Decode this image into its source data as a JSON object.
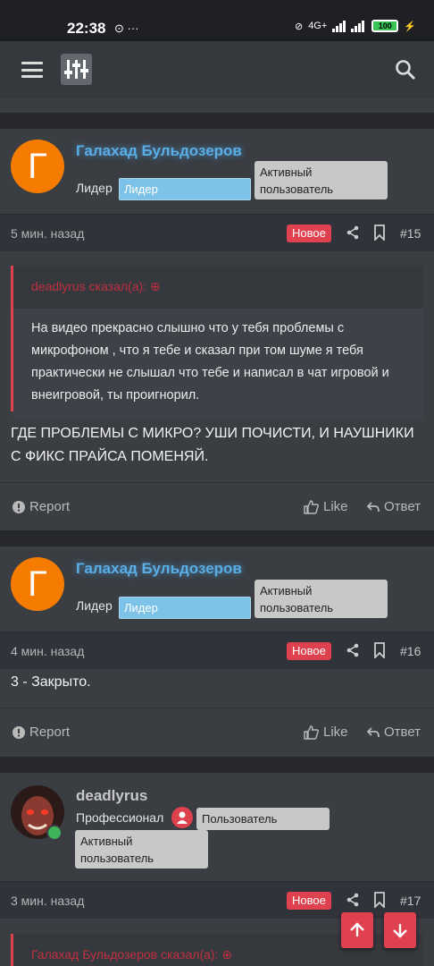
{
  "status_bar": {
    "time": "22:38",
    "notif": "⊙ ···",
    "net": "4G+",
    "battery": "100"
  },
  "top_bar": {
    "menu_icon": "hamburger-icon",
    "logo_icon": "equalizer-logo",
    "search_icon": "search-icon"
  },
  "posts": [
    {
      "avatar_letter": "Г",
      "username": "Галахад Бульдозеров",
      "role": "Лидер",
      "badge_primary": "Лидер",
      "badge_secondary_line1": "Активный",
      "badge_secondary_line2": "пользователь",
      "time": "5 мин. назад",
      "new_label": "Новое",
      "number": "#15",
      "quote_author": "deadlyrus сказал(а):",
      "quote_text": "На видео прекрасно слышно что у тебя проблемы с микрофоном , что я тебе и сказал при том шуме я тебя практически не слышал что тебе и написал в чат игровой и внеигровой, ты проигнорил.",
      "message": "ГДЕ ПРОБЛЕМЫ С МИКРО? УШИ ПОЧИСТИ, И НАУШНИКИ С ФИКС ПРАЙСА ПОМЕНЯЙ.",
      "report": "Report",
      "like": "Like",
      "reply": "Ответ"
    },
    {
      "avatar_letter": "Г",
      "username": "Галахад Бульдозеров",
      "role": "Лидер",
      "badge_primary": "Лидер",
      "badge_secondary_line1": "Активный",
      "badge_secondary_line2": "пользователь",
      "time": "4 мин. назад",
      "new_label": "Новое",
      "number": "#16",
      "message": "3 - Закрыто.",
      "report": "Report",
      "like": "Like",
      "reply": "Ответ"
    },
    {
      "username": "deadlyrus",
      "role": "Профессионал",
      "badge_primary": "Пользователь",
      "badge_secondary_line1": "Активный",
      "badge_secondary_line2": "пользователь",
      "time": "3 мин. назад",
      "new_label": "Новое",
      "number": "#17",
      "quote_author": "Галахад Бульдозеров сказал(а):"
    }
  ],
  "fab": {
    "up_icon": "arrow-up-icon",
    "down_icon": "arrow-down-icon"
  }
}
